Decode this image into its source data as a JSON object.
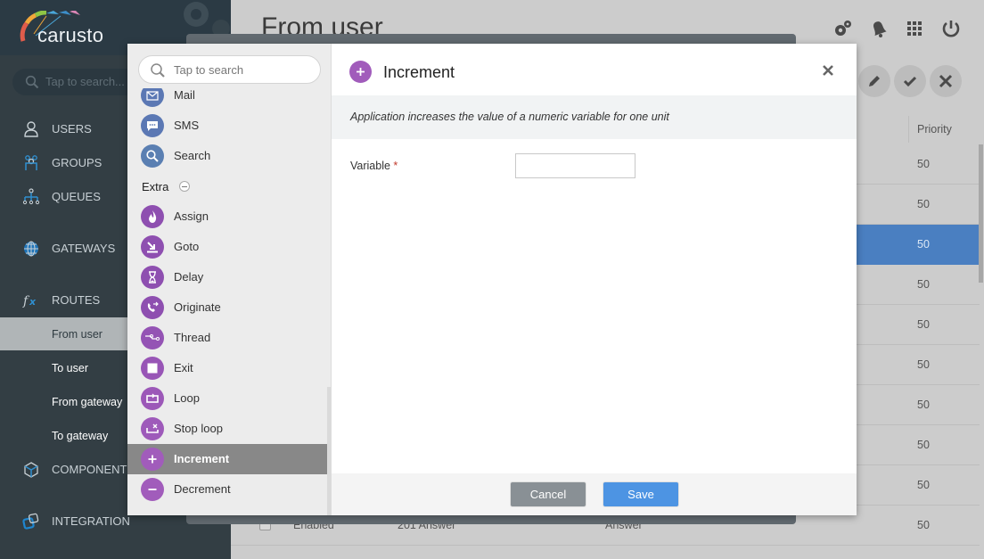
{
  "app": {
    "logo_text": "carusto"
  },
  "sidebar": {
    "search_placeholder": "Tap to search...",
    "items": [
      {
        "label": "USERS",
        "icon": "user-icon"
      },
      {
        "label": "GROUPS",
        "icon": "group-icon"
      },
      {
        "label": "QUEUES",
        "icon": "queue-icon"
      },
      {
        "label": "GATEWAYS",
        "icon": "globe-icon"
      },
      {
        "label": "ROUTES",
        "icon": "function-icon"
      },
      {
        "label": "COMPONENTS",
        "icon": "cube-icon"
      },
      {
        "label": "INTEGRATION",
        "icon": "integration-icon"
      }
    ],
    "route_subitems": [
      {
        "label": "From user",
        "active": true
      },
      {
        "label": "To user",
        "active": false
      },
      {
        "label": "From gateway",
        "active": false
      },
      {
        "label": "To gateway",
        "active": false
      }
    ]
  },
  "header": {
    "title": "From user",
    "icons": [
      "settings-icon",
      "notifications-icon",
      "apps-grid-icon",
      "power-icon"
    ],
    "actions": [
      "edit-icon",
      "confirm-icon",
      "cancel-icon"
    ]
  },
  "table": {
    "columns": {
      "priority": "Priority"
    },
    "rows": [
      {
        "priority": "50",
        "selected": false
      },
      {
        "priority": "50",
        "selected": false
      },
      {
        "priority": "50",
        "selected": true
      },
      {
        "priority": "50",
        "selected": false
      },
      {
        "priority": "50",
        "selected": false
      },
      {
        "priority": "50",
        "selected": false
      },
      {
        "priority": "50",
        "selected": false
      },
      {
        "priority": "50",
        "selected": false
      },
      {
        "priority": "50",
        "selected": false
      },
      {
        "status": "Enabled",
        "name": "201 Answer",
        "app": "Answer",
        "priority": "50",
        "selected": false
      }
    ]
  },
  "palette": {
    "search_placeholder": "Tap to search",
    "items_top": [
      {
        "label": "Mail",
        "icon": "mail-icon"
      },
      {
        "label": "SMS",
        "icon": "sms-icon"
      },
      {
        "label": "Search",
        "icon": "search-icon"
      }
    ],
    "group": {
      "label": "Extra",
      "toggle": "collapse-icon"
    },
    "items_extra": [
      {
        "label": "Assign",
        "icon": "flame-icon"
      },
      {
        "label": "Goto",
        "icon": "goto-icon"
      },
      {
        "label": "Delay",
        "icon": "hourglass-icon"
      },
      {
        "label": "Originate",
        "icon": "originate-call-icon"
      },
      {
        "label": "Thread",
        "icon": "thread-icon"
      },
      {
        "label": "Exit",
        "icon": "stop-square-icon"
      },
      {
        "label": "Loop",
        "icon": "loop-icon"
      },
      {
        "label": "Stop loop",
        "icon": "stop-loop-icon"
      },
      {
        "label": "Increment",
        "icon": "plus-icon",
        "selected": true
      },
      {
        "label": "Decrement",
        "icon": "minus-icon"
      }
    ]
  },
  "detail": {
    "title": "Increment",
    "description": "Application increases the value of a numeric variable for one unit",
    "fields": [
      {
        "label": "Variable",
        "required_mark": "*",
        "value": ""
      }
    ],
    "cancel_label": "Cancel",
    "save_label": "Save"
  }
}
